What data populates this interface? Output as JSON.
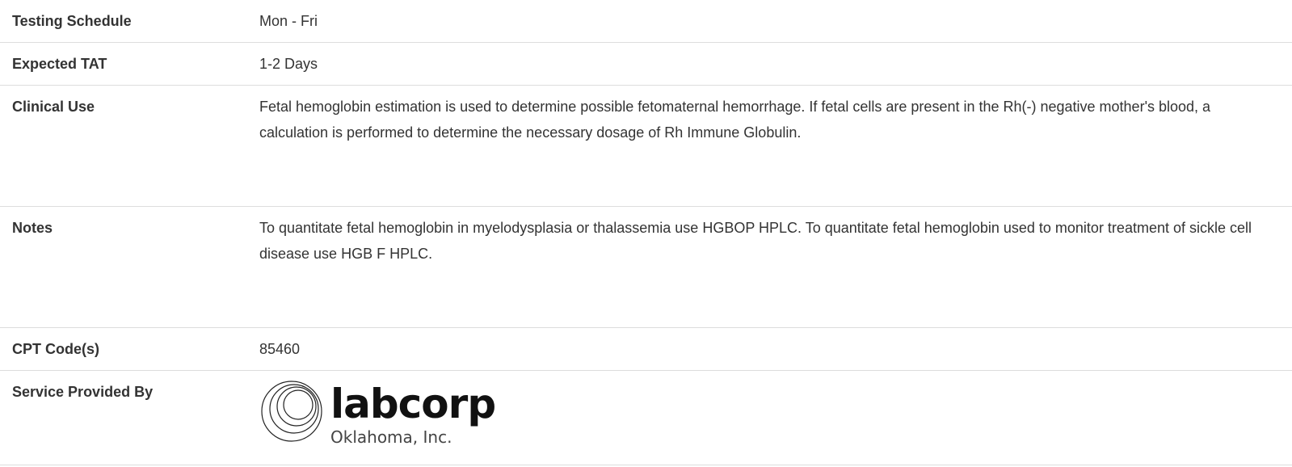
{
  "rows": [
    {
      "label": "Testing Schedule",
      "value": "Mon - Fri"
    },
    {
      "label": "Expected TAT",
      "value": "1-2 Days"
    },
    {
      "label": "Clinical Use",
      "value": "Fetal hemoglobin estimation is used to determine possible fetomaternal hemorrhage. If fetal cells are present in the Rh(-) negative mother's blood, a calculation is performed to determine the necessary dosage of Rh Immune Globulin."
    },
    {
      "label": "Notes",
      "value": "To quantitate fetal hemoglobin in myelodysplasia or thalassemia use HGBOP HPLC. To quantitate fetal hemoglobin used to monitor treatment of sickle cell disease use HGB F HPLC."
    },
    {
      "label": "CPT Code(s)",
      "value": "85460"
    },
    {
      "label": "Service Provided By"
    }
  ],
  "provider_logo": {
    "name": "labcorp",
    "subtitle": "Oklahoma, Inc."
  }
}
